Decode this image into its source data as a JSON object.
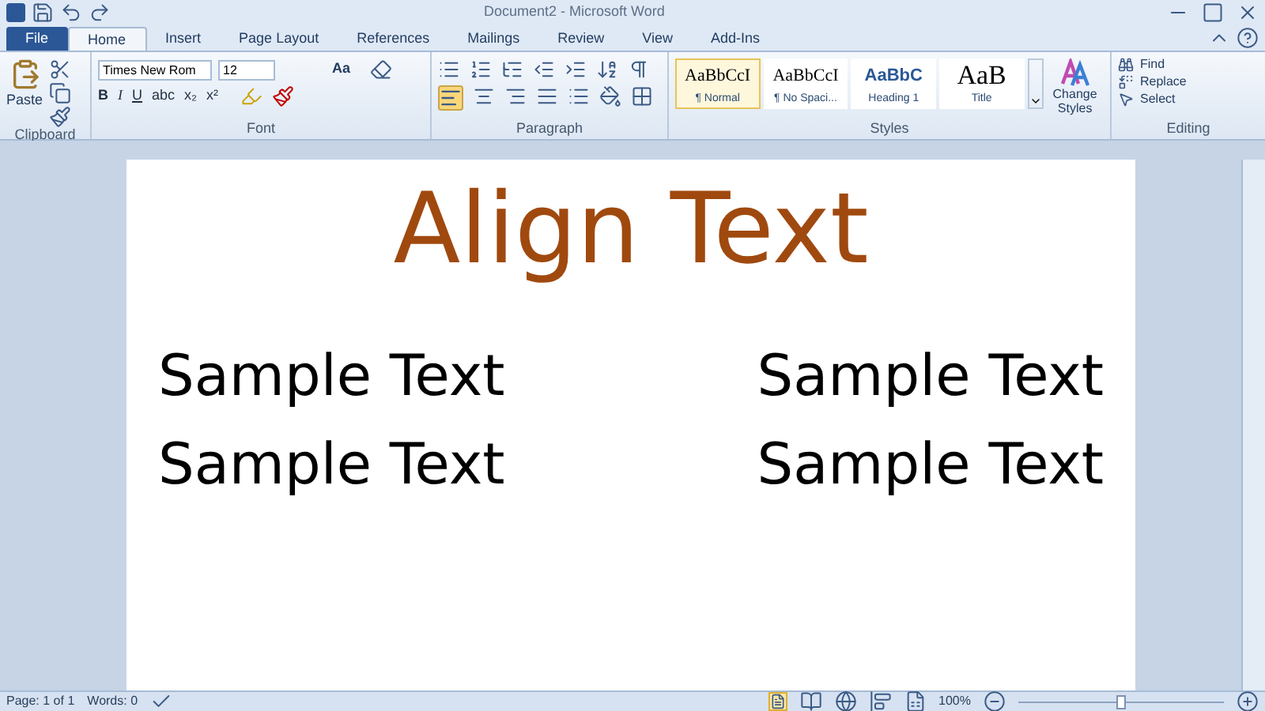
{
  "window": {
    "title": "Document2  -  Microsoft Word"
  },
  "tabs": [
    {
      "label": "File",
      "selected": false,
      "kind": "file"
    },
    {
      "label": "Home",
      "selected": true,
      "kind": "tab"
    },
    {
      "label": "Insert",
      "selected": false,
      "kind": "tab"
    },
    {
      "label": "Page Layout",
      "selected": false,
      "kind": "tab"
    },
    {
      "label": "References",
      "selected": false,
      "kind": "tab"
    },
    {
      "label": "Mailings",
      "selected": false,
      "kind": "tab"
    },
    {
      "label": "Review",
      "selected": false,
      "kind": "tab"
    },
    {
      "label": "View",
      "selected": false,
      "kind": "tab"
    },
    {
      "label": "Add-Ins",
      "selected": false,
      "kind": "tab"
    }
  ],
  "clipboard": {
    "paste": "Paste",
    "group": "Clipboard"
  },
  "font": {
    "name": "Times New Rom",
    "size": "12",
    "case": "Aa",
    "format_buttons": [
      "B",
      "I",
      "U",
      "abc",
      "x₂",
      "x²"
    ],
    "group": "Font"
  },
  "paragraph": {
    "group": "Paragraph"
  },
  "styles": {
    "items": [
      {
        "preview": "AaBbCcI",
        "label": "¶ Normal",
        "selected": true,
        "kind": "body"
      },
      {
        "preview": "AaBbCcI",
        "label": "¶ No Spaci...",
        "selected": false,
        "kind": "body"
      },
      {
        "preview": "AaBbC",
        "label": "Heading 1",
        "selected": false,
        "kind": "heading"
      },
      {
        "preview": "AaB",
        "label": "Title",
        "selected": false,
        "kind": "title"
      }
    ],
    "change": "Change Styles",
    "group": "Styles"
  },
  "editing": {
    "items": [
      "Find",
      "Replace",
      "Select"
    ],
    "group": "Editing"
  },
  "document": {
    "heading": "Align Text",
    "rows": [
      {
        "left": "Sample Text",
        "right": "Sample Text"
      },
      {
        "left": "Sample Text",
        "right": "Sample Text"
      }
    ]
  },
  "status_bar": {
    "page": "Page: 1 of 1",
    "words": "Words: 0",
    "zoom": "100%",
    "zoom_slider": {
      "level": 0.5
    }
  }
}
